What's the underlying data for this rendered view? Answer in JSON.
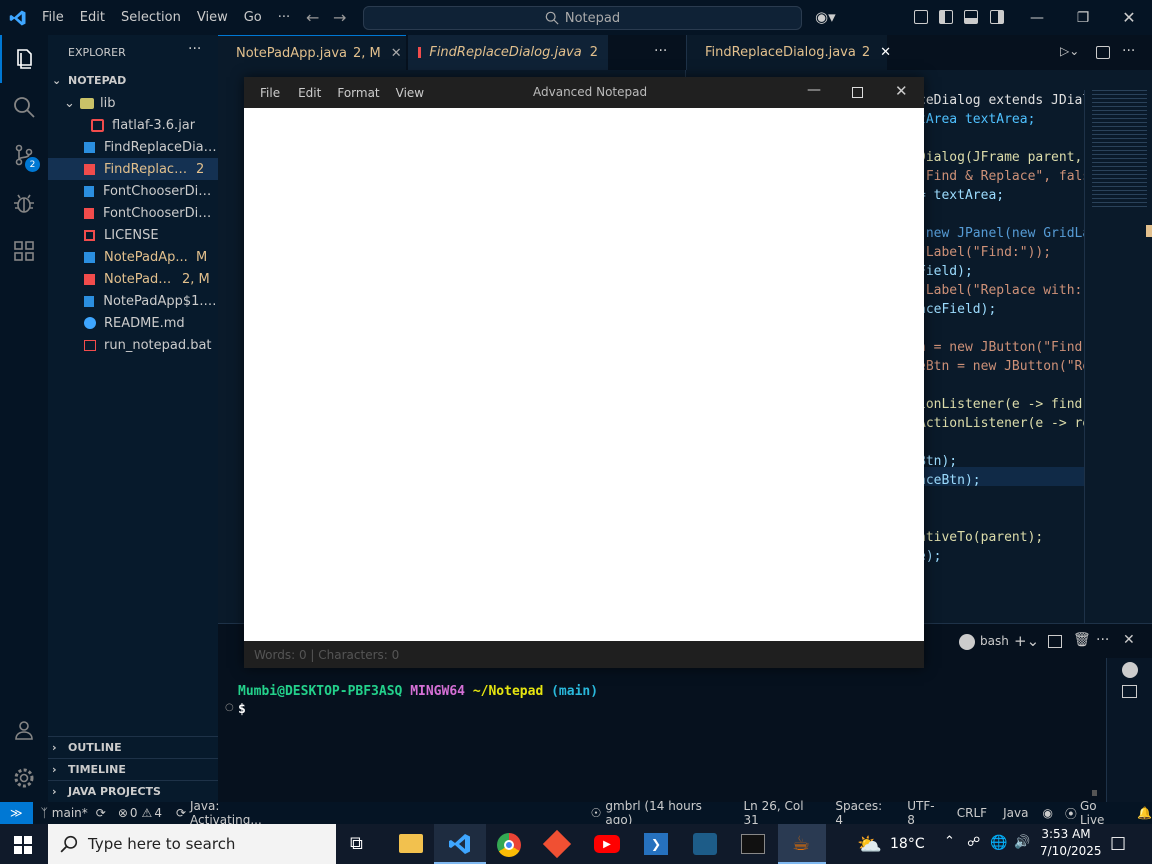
{
  "titlebar": {
    "menu": [
      "File",
      "Edit",
      "Selection",
      "View",
      "Go",
      "···"
    ],
    "search": "Notepad"
  },
  "activity": {
    "scm_badge": "2"
  },
  "explorer": {
    "header": "EXPLORER",
    "root": "NOTEPAD",
    "items": [
      {
        "label": "lib",
        "badge": "",
        "color": "#cccccc"
      },
      {
        "label": "flatlaf-3.6.jar",
        "badge": "",
        "color": "#cccccc"
      },
      {
        "label": "FindReplaceDialo...",
        "badge": "",
        "color": "#cccccc"
      },
      {
        "label": "FindReplace...",
        "badge": "2",
        "color": "#e2c08d"
      },
      {
        "label": "FontChooserDialo...",
        "badge": "",
        "color": "#cccccc"
      },
      {
        "label": "FontChooserDialo...",
        "badge": "",
        "color": "#cccccc"
      },
      {
        "label": "LICENSE",
        "badge": "",
        "color": "#cccccc"
      },
      {
        "label": "NotePadAp...",
        "badge": "M",
        "color": "#e2c08d"
      },
      {
        "label": "NotePadA...",
        "badge": "2, M",
        "color": "#e2c08d"
      },
      {
        "label": "NotePadApp$1.cl...",
        "badge": "",
        "color": "#cccccc"
      },
      {
        "label": "README.md",
        "badge": "",
        "color": "#cccccc"
      },
      {
        "label": "run_notepad.bat",
        "badge": "",
        "color": "#cccccc"
      }
    ],
    "sections": [
      "OUTLINE",
      "TIMELINE",
      "JAVA PROJECTS"
    ]
  },
  "tabs": [
    {
      "label": "NotePadApp.java",
      "badge": "2, M"
    },
    {
      "label": "FindReplaceDialog.java",
      "badge": "2"
    },
    {
      "label": "FindReplaceDialog.java",
      "badge": "2"
    }
  ],
  "code_lines": [
    {
      "text": "ceDialog extends JDial",
      "color": "#e0e0e0"
    },
    {
      "text": "tArea textArea;",
      "color": "#4fc1ff"
    },
    {
      "text": "",
      "color": "#cccccc"
    },
    {
      "text": "Dialog(JFrame parent,",
      "color": "#dcdcaa"
    },
    {
      "text": "\"Find & Replace\", fals",
      "color": "#ce9178"
    },
    {
      "text": "= textArea;",
      "color": "#9cdcfe"
    },
    {
      "text": "",
      "color": "#cccccc"
    },
    {
      "text": " new JPanel(new GridLa",
      "color": "#569cd6"
    },
    {
      "text": "JLabel(\"Find:\"));",
      "color": "#ce9178"
    },
    {
      "text": "Field);",
      "color": "#9cdcfe"
    },
    {
      "text": "JLabel(\"Replace with:",
      "color": "#ce9178"
    },
    {
      "text": "aceField);",
      "color": "#9cdcfe"
    },
    {
      "text": "",
      "color": "#cccccc"
    },
    {
      "text": "n = new JButton(\"Find",
      "color": "#ce9178"
    },
    {
      "text": "eBtn = new JButton(\"Re",
      "color": "#ce9178"
    },
    {
      "text": "",
      "color": "#cccccc"
    },
    {
      "text": "ionListener(e -> find",
      "color": "#dcdcaa"
    },
    {
      "text": "ActionListener(e -> re",
      "color": "#dcdcaa"
    },
    {
      "text": "",
      "color": "#cccccc"
    },
    {
      "text": "Btn);",
      "color": "#9cdcfe"
    },
    {
      "text": "aceBtn);",
      "color": "#9cdcfe"
    },
    {
      "text": "",
      "color": "#cccccc"
    },
    {
      "text": "",
      "color": "#cccccc"
    },
    {
      "text": "ativeTo(parent);",
      "color": "#dcdcaa"
    },
    {
      "text": "e);",
      "color": "#9cdcfe"
    }
  ],
  "terminal": {
    "shell": "bash",
    "prompt_user": "Mumbi@DESKTOP-PBF3ASQ",
    "prompt_env": "MINGW64",
    "prompt_path": "~/Notepad",
    "prompt_branch": "(main)",
    "prompt_symbol": "$"
  },
  "notepad": {
    "title": "Advanced Notepad",
    "menu": [
      "File",
      "Edit",
      "Format",
      "View"
    ],
    "status": "Words: 0 | Characters: 0"
  },
  "statusbar": {
    "branch": "main*",
    "errors": "0",
    "warnings": "4",
    "java": "Java: Activating...",
    "blame": "gmbrl (14 hours ago)",
    "position": "Ln 26, Col 31",
    "spaces": "Spaces: 4",
    "encoding": "UTF-8",
    "eol": "CRLF",
    "language": "Java",
    "golive": "Go Live"
  },
  "taskbar": {
    "search_placeholder": "Type here to search",
    "weather": "18°C",
    "time": "3:53 AM",
    "date": "7/10/2025"
  },
  "colors": {
    "accent": "#0078d4",
    "modified": "#e2c08d",
    "error_file": "#f14c4c"
  }
}
